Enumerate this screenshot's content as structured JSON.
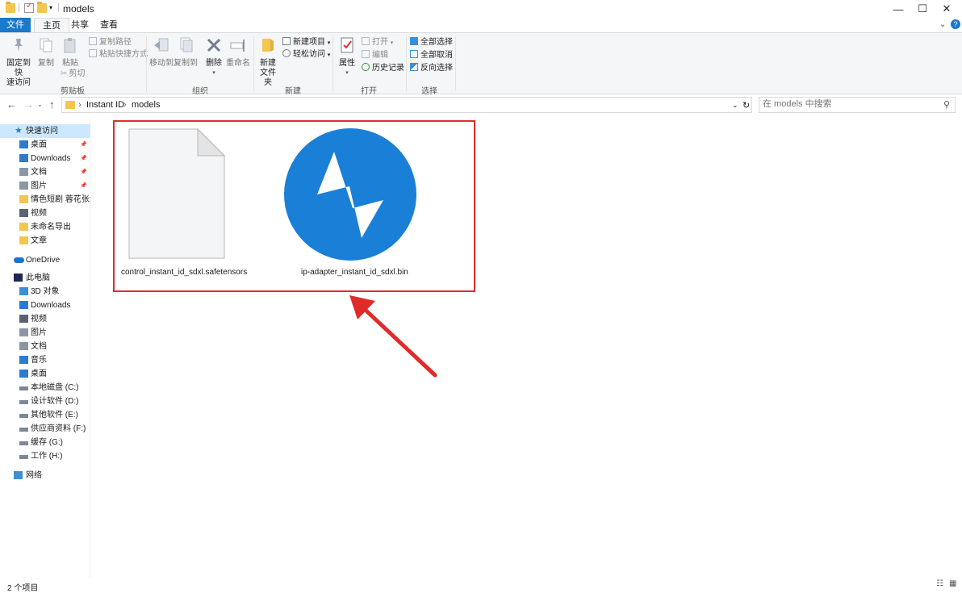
{
  "titlebar": {
    "title": "models",
    "minimize": "—",
    "maximize": "☐",
    "close": "✕"
  },
  "tabs": [
    "文件",
    "主页",
    "共享",
    "查看"
  ],
  "ribbon": {
    "clipboard": {
      "pin_label_1": "固定到快",
      "pin_label_2": "速访问",
      "copy": "复制",
      "paste": "粘贴",
      "copy_path": "复制路径",
      "paste_shortcut": "粘贴快捷方式",
      "cut": "剪切",
      "group": "剪贴板"
    },
    "organize": {
      "move_to": "移动到",
      "copy_to": "复制到",
      "delete": "删除",
      "rename": "重命名",
      "group": "组织"
    },
    "new": {
      "new_folder_1": "新建",
      "new_folder_2": "文件夹",
      "new_item": "新建项目",
      "easy_access": "轻松访问",
      "group": "新建"
    },
    "open": {
      "properties": "属性",
      "open": "打开",
      "edit": "编辑",
      "history": "历史记录",
      "group": "打开"
    },
    "select": {
      "select_all": "全部选择",
      "select_none": "全部取消",
      "invert": "反向选择",
      "group": "选择"
    }
  },
  "address": {
    "crumbs": [
      "Instant ID",
      "models"
    ],
    "search_placeholder": "在 models 中搜索"
  },
  "sidebar": {
    "quick_access": "快速访问",
    "quick_items": [
      "桌面",
      "Downloads",
      "文档",
      "图片",
      "情色短剧 蓉花张津瑜",
      "视频",
      "未命名导出",
      "文章"
    ],
    "onedrive": "OneDrive",
    "this_pc": "此电脑",
    "pc_items": [
      "3D 对象",
      "Downloads",
      "视频",
      "图片",
      "文档",
      "音乐",
      "桌面",
      "本地磁盘 (C:)",
      "设计软件 (D:)",
      "其他软件 (E:)",
      "供应商资料 (F:)",
      "缓存 (G:)",
      "工作 (H:)"
    ],
    "network": "网络"
  },
  "files": [
    {
      "name": "control_instant_id_sdxl.safetensors",
      "icon": "blank-file-icon"
    },
    {
      "name": "ip-adapter_instant_id_sdxl.bin",
      "icon": "lightning-app-icon"
    }
  ],
  "status": {
    "count": "2 个项目"
  },
  "colors": {
    "accent": "#1979ca",
    "highlight": "#e02b2b",
    "app_icon": "#1a7fd6"
  }
}
